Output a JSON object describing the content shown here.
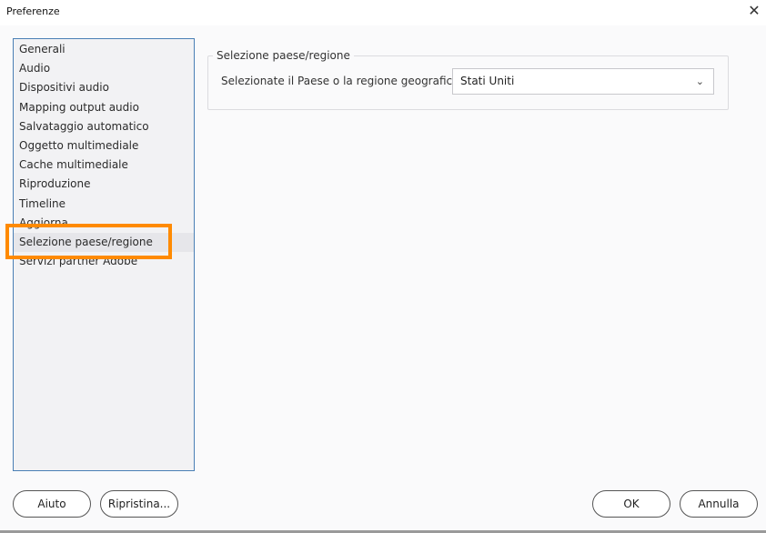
{
  "window": {
    "title": "Preferenze",
    "close_icon": "close-icon"
  },
  "sidebar": {
    "items": [
      {
        "label": "Generali"
      },
      {
        "label": "Audio"
      },
      {
        "label": "Dispositivi audio"
      },
      {
        "label": "Mapping output audio"
      },
      {
        "label": "Salvataggio automatico"
      },
      {
        "label": "Oggetto multimediale"
      },
      {
        "label": "Cache multimediale"
      },
      {
        "label": "Riproduzione"
      },
      {
        "label": "Timeline"
      },
      {
        "label": "Aggiorna"
      },
      {
        "label": "Selezione paese/regione",
        "selected": true
      },
      {
        "label": "Servizi partner Adobe"
      }
    ],
    "highlight_color": "#ff8a00"
  },
  "panel": {
    "group_title": "Selezione paese/regione",
    "field_label": "Selezionate il Paese o la regione geografica:",
    "select_value": "Stati Uniti"
  },
  "buttons": {
    "help": "Aiuto",
    "reset": "Ripristina...",
    "ok": "OK",
    "cancel": "Annulla"
  }
}
